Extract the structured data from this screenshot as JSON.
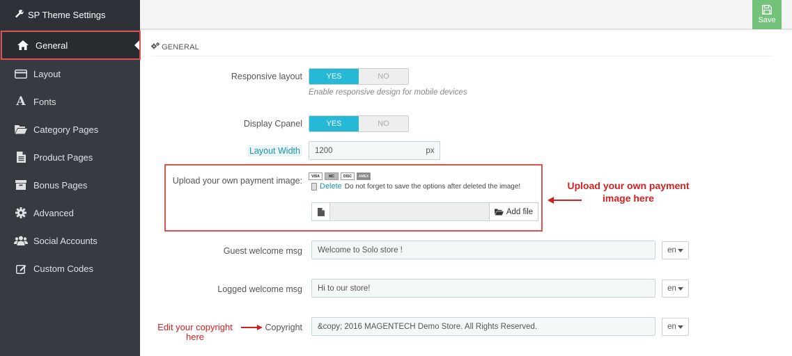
{
  "sidebar": {
    "title": "SP Theme Settings",
    "items": [
      {
        "label": "General",
        "icon": "home-icon"
      },
      {
        "label": "Layout",
        "icon": "layout-icon"
      },
      {
        "label": "Fonts",
        "icon": "font-icon"
      },
      {
        "label": "Category Pages",
        "icon": "folder-open-icon"
      },
      {
        "label": "Product Pages",
        "icon": "file-icon"
      },
      {
        "label": "Bonus Pages",
        "icon": "archive-icon"
      },
      {
        "label": "Advanced",
        "icon": "cog-icon"
      },
      {
        "label": "Social Accounts",
        "icon": "users-icon"
      },
      {
        "label": "Custom Codes",
        "icon": "edit-icon"
      }
    ]
  },
  "toolbar": {
    "save_label": "Save"
  },
  "panel": {
    "heading": "GENERAL",
    "responsive_layout": {
      "label": "Responsive layout",
      "yes": "YES",
      "no": "NO",
      "help": "Enable responsive design for mobile devices"
    },
    "display_cpanel": {
      "label": "Display Cpanel",
      "yes": "YES",
      "no": "NO"
    },
    "layout_width": {
      "label": "Layout Width",
      "value": "1200",
      "unit": "px"
    },
    "payment_image": {
      "label": "Upload your own payment image:",
      "cards": [
        "VISA",
        "MC",
        "DISC",
        "AMEX"
      ],
      "delete_label": "Delete",
      "delete_note": "Do not forget to save the options after deleted the image!",
      "add_file_label": "Add file"
    },
    "guest_welcome": {
      "label": "Guest welcome msg",
      "value": "Welcome to Solo store !",
      "lang": "en"
    },
    "logged_welcome": {
      "label": "Logged welcome msg",
      "value": "Hi to our store!",
      "lang": "en"
    },
    "copyright": {
      "label": "Copyright",
      "value": "&copy; 2016 MAGENTECH Demo Store. All Rights Reserved.",
      "lang": "en"
    }
  },
  "annotations": {
    "upload": "Upload your own payment image here",
    "copyright": "Edit your copyright here"
  },
  "colors": {
    "accent": "#25b9d7",
    "save": "#72c279",
    "sidebar": "#363a41",
    "annotation": "#d42020"
  }
}
